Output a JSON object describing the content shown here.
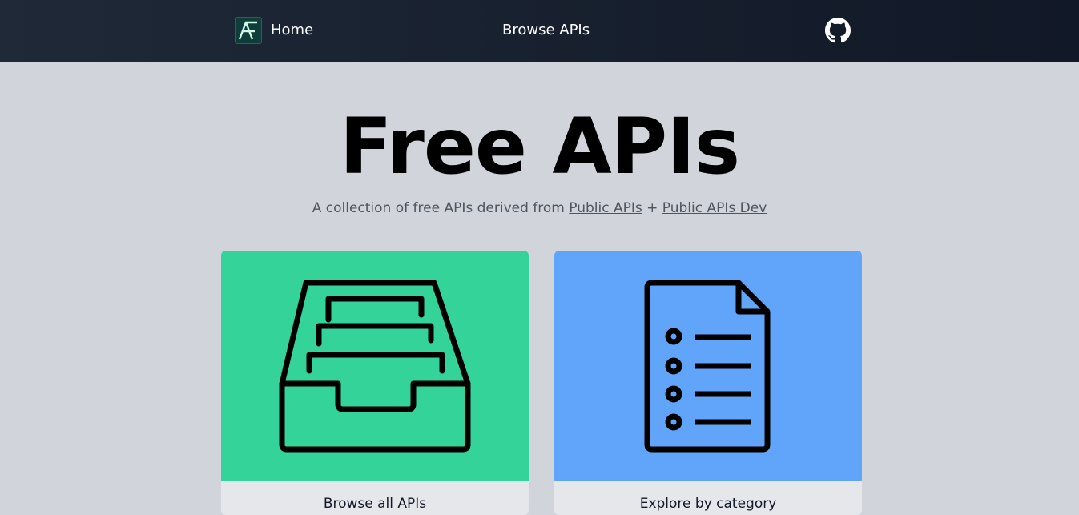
{
  "nav": {
    "logo_icon": "af-logo-icon",
    "home_label": "Home",
    "browse_label": "Browse APIs",
    "github_icon": "github-icon"
  },
  "hero": {
    "title": "Free APIs",
    "subtitle_prefix": "A collection of free APIs derived from ",
    "link1": "Public APIs",
    "separator": " + ",
    "link2": "Public APIs Dev"
  },
  "cards": [
    {
      "icon": "file-cabinet-icon",
      "color": "#34d399",
      "label": "Browse all APIs"
    },
    {
      "icon": "document-list-icon",
      "color": "#60a5fa",
      "label": "Explore by category"
    }
  ],
  "colors": {
    "nav_bg": "#1f2937",
    "page_bg": "#d1d5db",
    "card_label_bg": "#e5e7eb"
  }
}
